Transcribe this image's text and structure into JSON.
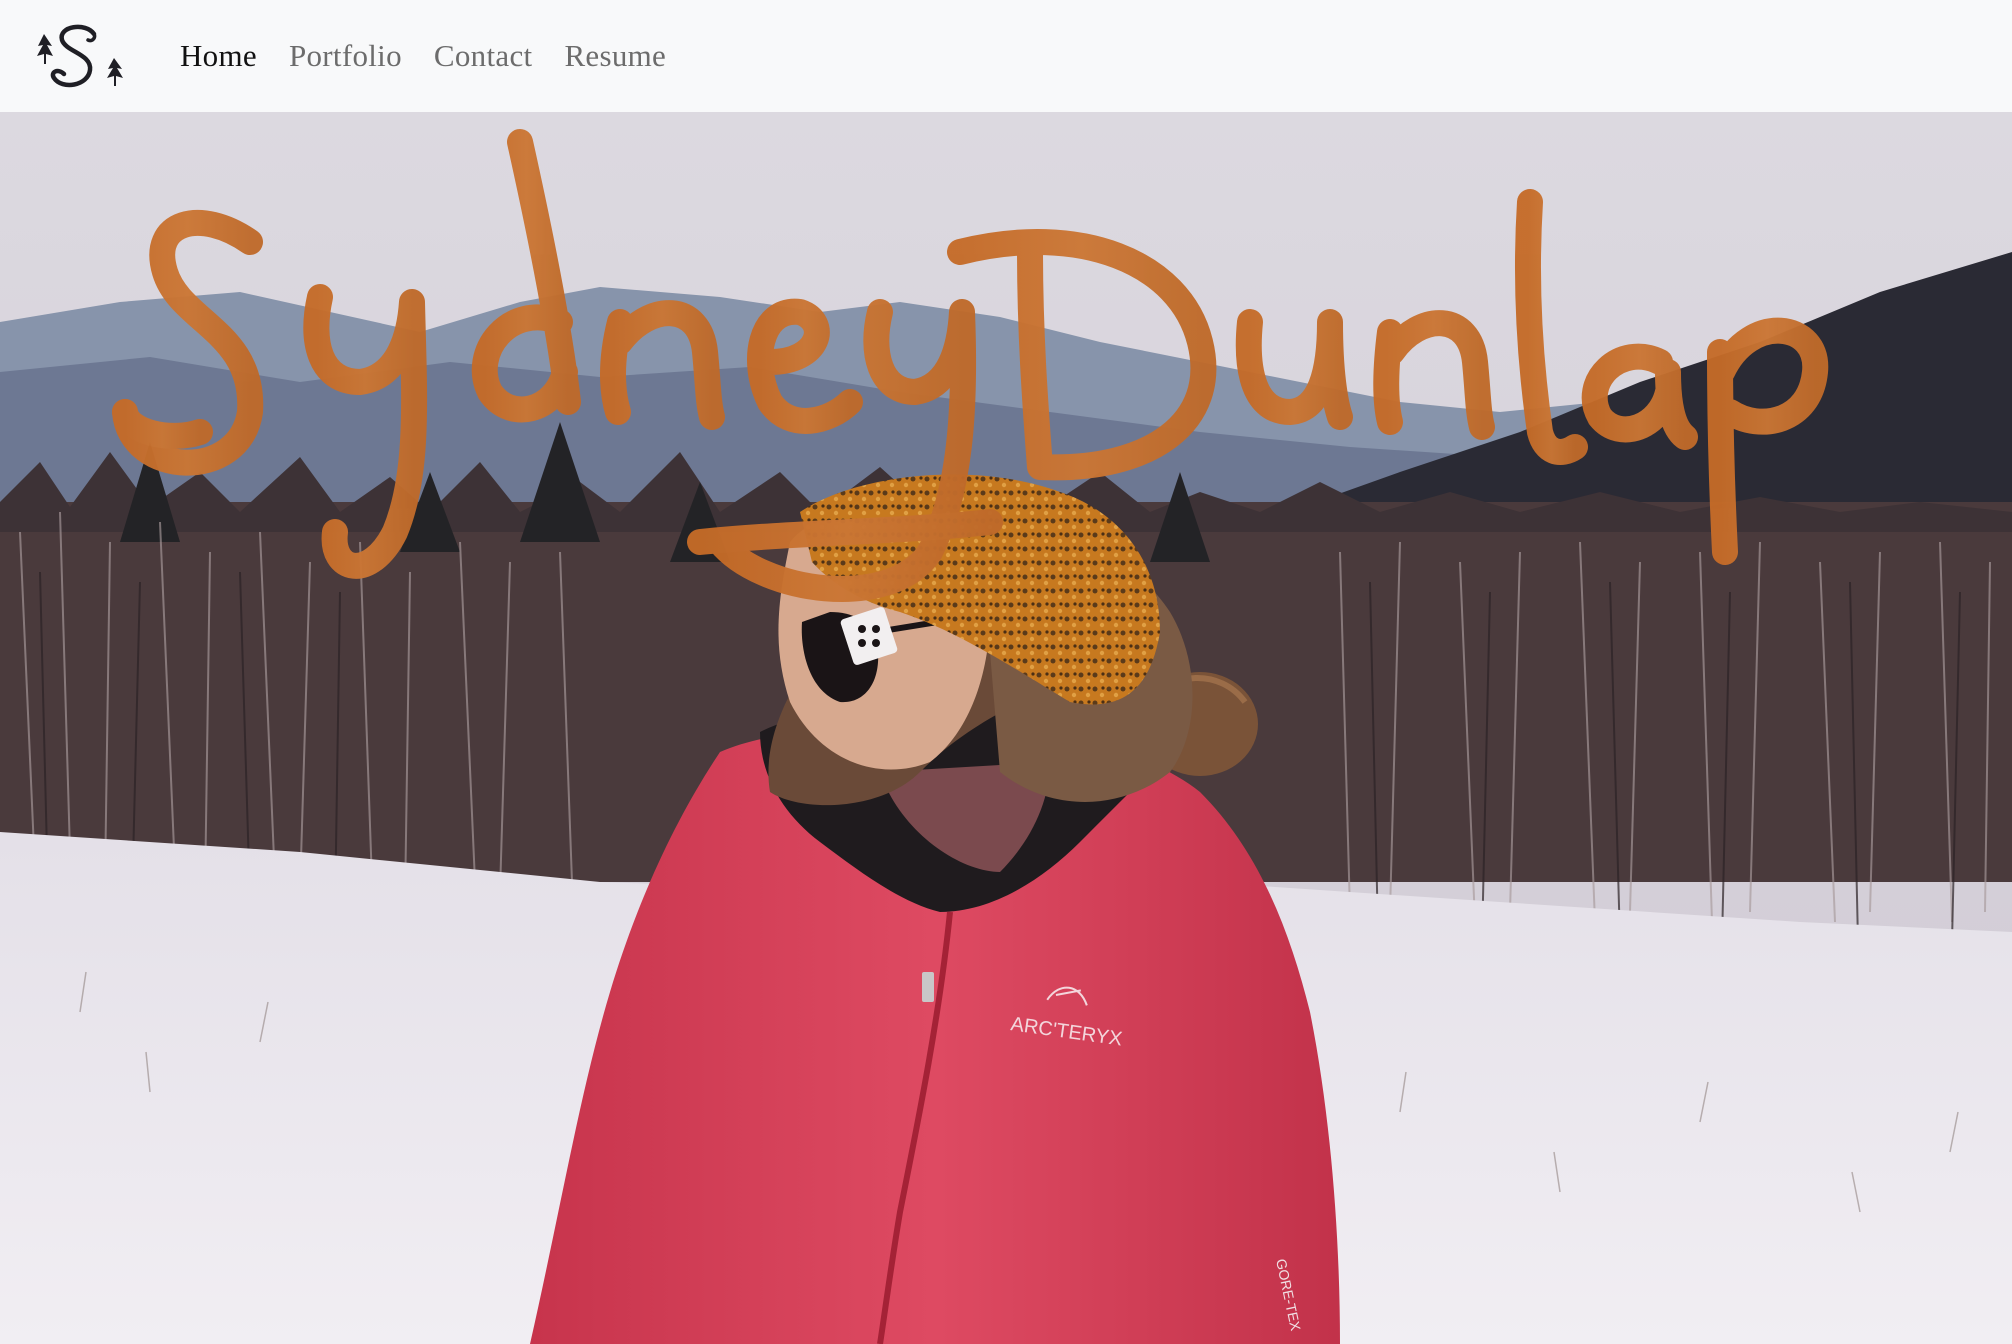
{
  "nav": {
    "links": [
      {
        "label": "Home",
        "active": true
      },
      {
        "label": "Portfolio",
        "active": false
      },
      {
        "label": "Contact",
        "active": false
      },
      {
        "label": "Resume",
        "active": false
      }
    ]
  },
  "hero": {
    "signature_text": "Sydney Dunlap",
    "jacket_brand": "ARC'TERYX",
    "jacket_tag": "GORE-TEX"
  },
  "colors": {
    "nav_bg": "#f8f9fa",
    "signature": "#c86f2c",
    "jacket": "#d83c55",
    "snow": "#ece9ef",
    "headband": "#c7791f"
  }
}
